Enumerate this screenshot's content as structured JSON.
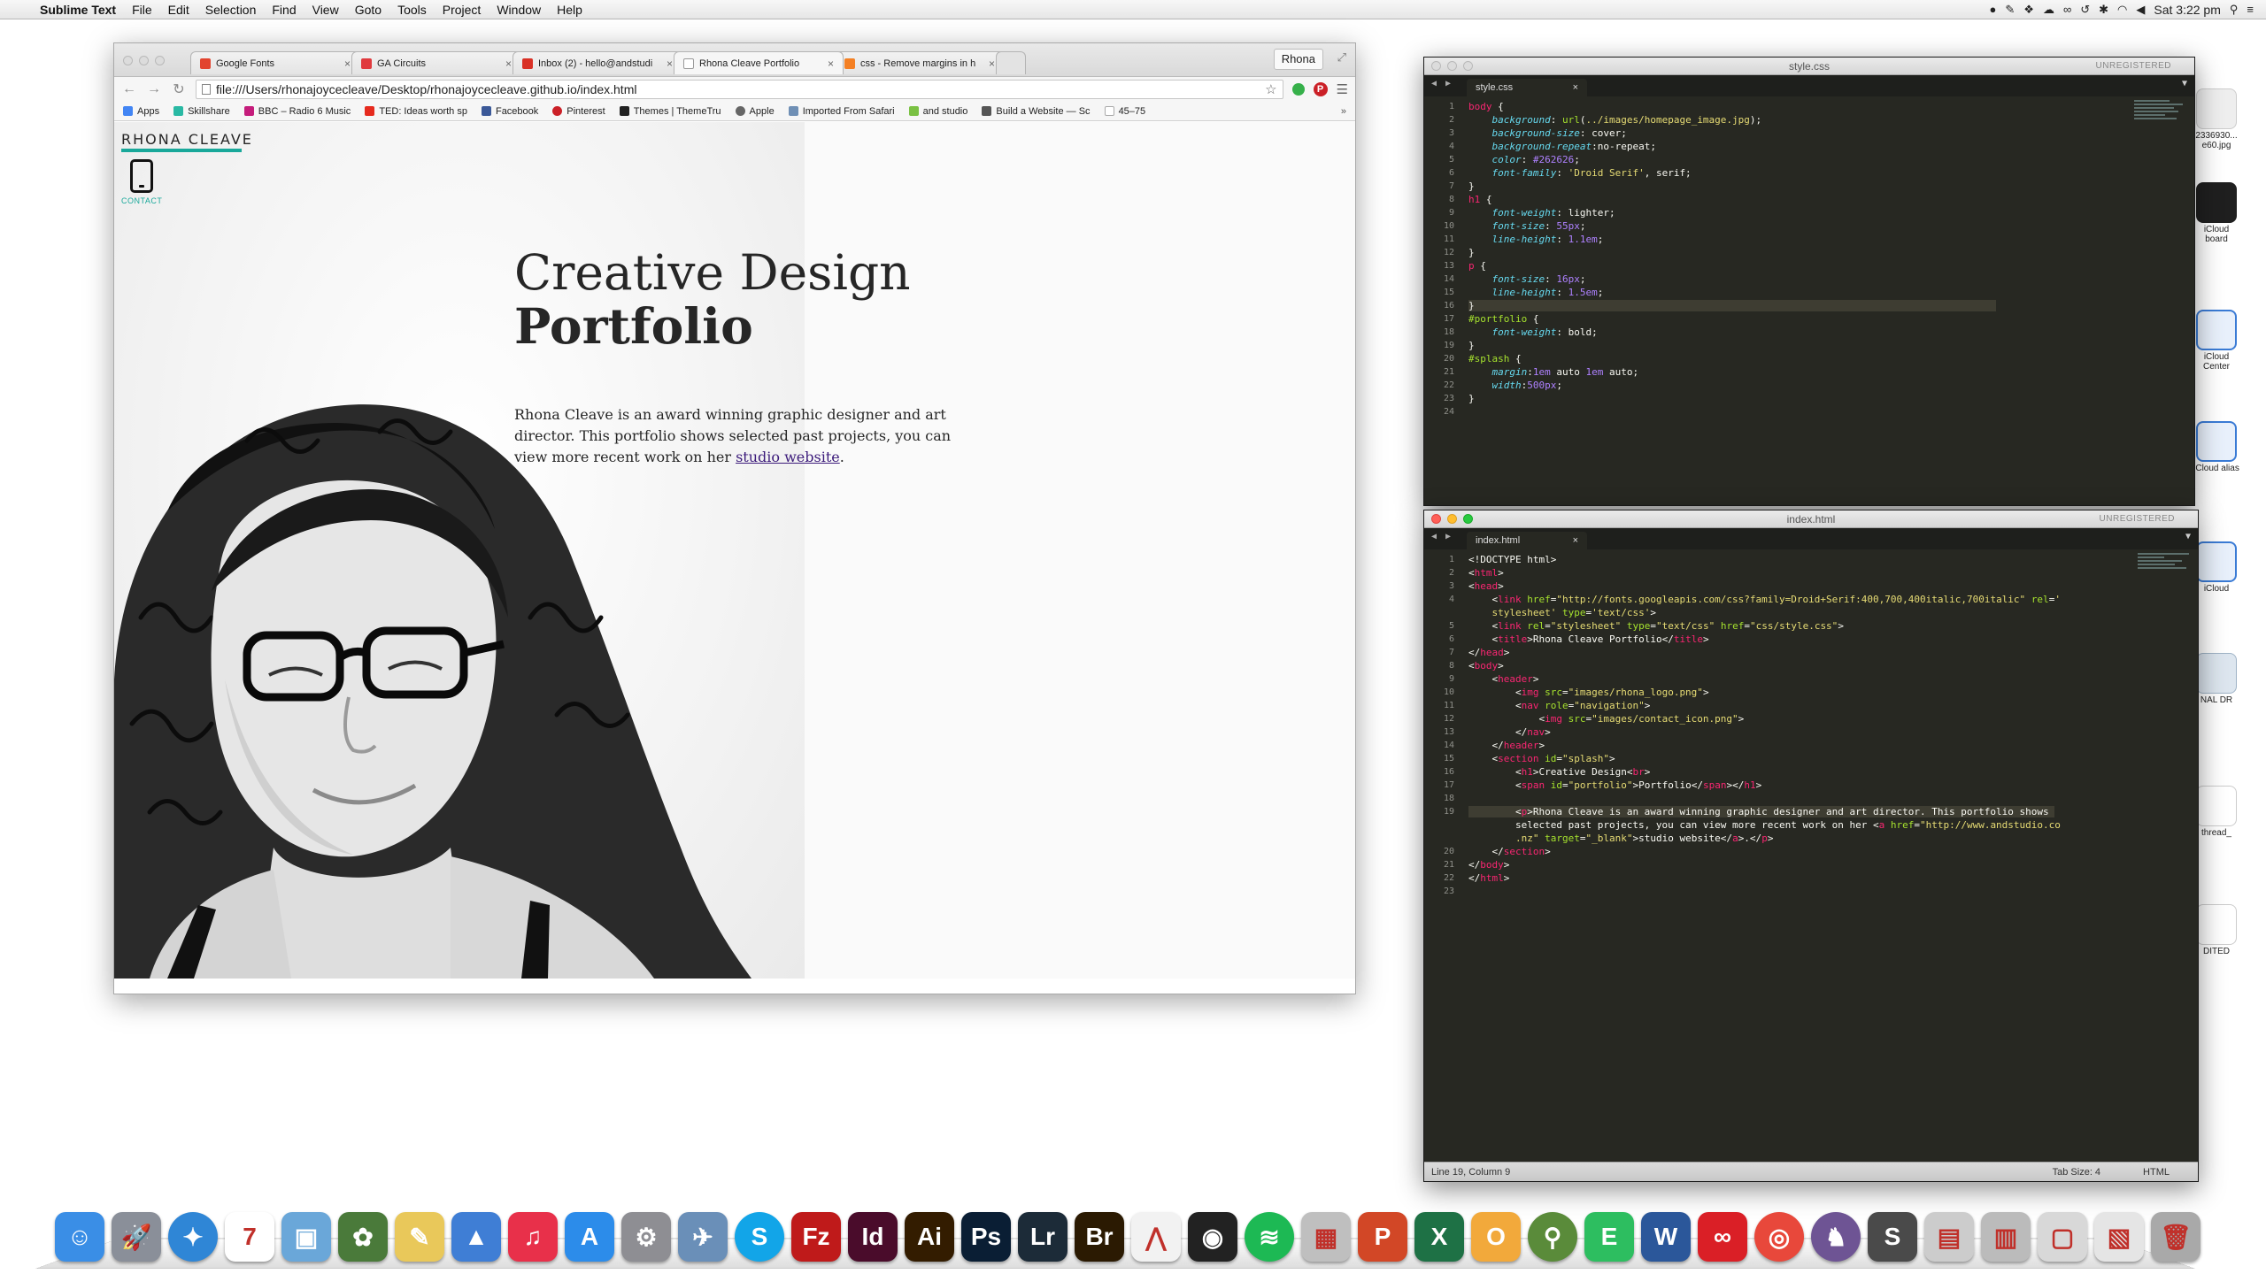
{
  "menubar": {
    "app_name": "Sublime Text",
    "menus": [
      "File",
      "Edit",
      "Selection",
      "Find",
      "View",
      "Goto",
      "Tools",
      "Project",
      "Window",
      "Help"
    ],
    "clock": "Sat 3:22 pm"
  },
  "browser": {
    "tabs": [
      {
        "title": "Google Fonts",
        "color": "#e2442f"
      },
      {
        "title": "GA Circuits",
        "color": "#e03a3e"
      },
      {
        "title": "Inbox (2) - hello@andstudi",
        "color": "#d93025"
      },
      {
        "title": "Rhona Cleave Portfolio",
        "color": "#9a9a9a"
      },
      {
        "title": "css - Remove margins in h",
        "color": "#f48024"
      }
    ],
    "active_tab": 3,
    "profile_label": "Rhona",
    "url": "file:///Users/rhonajoycecleave/Desktop/rhonajoycecleave.github.io/index.html",
    "bookmarks": [
      {
        "label": "Apps",
        "color": "#4285f4"
      },
      {
        "label": "Skillshare",
        "color": "#2ab9a4"
      },
      {
        "label": "BBC – Radio 6 Music",
        "color": "#c51d7c"
      },
      {
        "label": "TED: Ideas worth sp",
        "color": "#e62b1e"
      },
      {
        "label": "Facebook",
        "color": "#3b5998"
      },
      {
        "label": "Pinterest",
        "color": "#cb2027"
      },
      {
        "label": "Themes | ThemeTru",
        "color": "#222222"
      },
      {
        "label": "Apple",
        "color": "#666666"
      },
      {
        "label": "Imported From Safari",
        "color": "#6f8fb5"
      },
      {
        "label": "and studio",
        "color": "#7ac143"
      },
      {
        "label": "Build a Website — Sc",
        "color": "#555555"
      },
      {
        "label": "45–75",
        "color": "#aaaaaa"
      }
    ],
    "more_label": "»"
  },
  "site": {
    "logo": "RHONA CLEAVE",
    "contact_label": "CONTACT",
    "heading_line1": "Creative Design",
    "heading_line2": "Portfolio",
    "intro_text": "Rhona Cleave is an award winning graphic designer and art director. This portfolio shows selected past projects, you can view more recent work on her ",
    "link_text": "studio website",
    "intro_end": ".",
    "accent": "#19a89a"
  },
  "css_window": {
    "title": "style.css",
    "tab": "style.css",
    "unregistered": "UNREGISTERED",
    "line_numbers": [
      "1",
      "2",
      "3",
      "4",
      "5",
      "6",
      "7",
      "8",
      "9",
      "10",
      "11",
      "12",
      "13",
      "14",
      "15",
      "16",
      "17",
      "18",
      "19",
      "20",
      "21",
      "22",
      "23",
      "24"
    ]
  },
  "html_window": {
    "title": "index.html",
    "tab": "index.html",
    "unregistered": "UNREGISTERED",
    "line_numbers": [
      "1",
      "2",
      "3",
      "4",
      "",
      "5",
      "6",
      "7",
      "8",
      "9",
      "10",
      "11",
      "12",
      "13",
      "14",
      "15",
      "16",
      "17",
      "18",
      "19",
      "",
      "",
      "20",
      "21",
      "22",
      "23"
    ],
    "status_position": "Line 19, Column 9",
    "status_tabsize": "Tab Size: 4",
    "status_syntax": "HTML"
  },
  "desktop_icons": [
    "2336930... e60.jpg",
    "iCloud board",
    "iCloud Center",
    "iCloud alias",
    "iCloud",
    "NAL DR",
    "thread_",
    "DITED"
  ],
  "dock": [
    {
      "name": "finder",
      "glyph": "☺",
      "color": "#3a8ee6"
    },
    {
      "name": "launchpad",
      "glyph": "🚀",
      "color": "#8a8f99"
    },
    {
      "name": "safari",
      "glyph": "✦",
      "color": "#2f86d6"
    },
    {
      "name": "calendar",
      "glyph": "7",
      "color": "#ffffff"
    },
    {
      "name": "preview",
      "glyph": "▣",
      "color": "#6aa7d9"
    },
    {
      "name": "iphoto",
      "glyph": "✿",
      "color": "#4a7a3a"
    },
    {
      "name": "notes",
      "glyph": "✎",
      "color": "#e9c85a"
    },
    {
      "name": "keynote",
      "glyph": "▲",
      "color": "#3f7ed5"
    },
    {
      "name": "itunes",
      "glyph": "♫",
      "color": "#e8304a"
    },
    {
      "name": "app-store",
      "glyph": "A",
      "color": "#2c8cea"
    },
    {
      "name": "system-preferences",
      "glyph": "⚙",
      "color": "#8e8e93"
    },
    {
      "name": "directory-utility",
      "glyph": "✈",
      "color": "#6a8fb8"
    },
    {
      "name": "skype",
      "glyph": "S",
      "color": "#12a5e8"
    },
    {
      "name": "filezilla",
      "glyph": "Fz",
      "color": "#bf1a1a"
    },
    {
      "name": "indesign",
      "glyph": "Id",
      "color": "#4a0c2b"
    },
    {
      "name": "illustrator",
      "glyph": "Ai",
      "color": "#331c00"
    },
    {
      "name": "photoshop",
      "glyph": "Ps",
      "color": "#0a1e34"
    },
    {
      "name": "lightroom",
      "glyph": "Lr",
      "color": "#1c2b38"
    },
    {
      "name": "bridge",
      "glyph": "Br",
      "color": "#2b1a02"
    },
    {
      "name": "acrobat",
      "glyph": "⋀",
      "color": "#f2f2f2"
    },
    {
      "name": "quicktime",
      "glyph": "◉",
      "color": "#222222"
    },
    {
      "name": "spotify",
      "glyph": "≋",
      "color": "#1db954"
    },
    {
      "name": "calculator",
      "glyph": "▦",
      "color": "#bfbfbf"
    },
    {
      "name": "powerpoint",
      "glyph": "P",
      "color": "#d24726"
    },
    {
      "name": "excel",
      "glyph": "X",
      "color": "#1e7145"
    },
    {
      "name": "outlook",
      "glyph": "O",
      "color": "#f2a93b"
    },
    {
      "name": "network",
      "glyph": "⚲",
      "color": "#5a8b3a"
    },
    {
      "name": "evernote",
      "glyph": "E",
      "color": "#2dbe60"
    },
    {
      "name": "word",
      "glyph": "W",
      "color": "#2b579a"
    },
    {
      "name": "creative-cloud",
      "glyph": "∞",
      "color": "#da1f26"
    },
    {
      "name": "chrome",
      "glyph": "◎",
      "color": "#e8483b"
    },
    {
      "name": "github",
      "glyph": "♞",
      "color": "#6e5494"
    },
    {
      "name": "sublime-text",
      "glyph": "S",
      "color": "#4a4a4a"
    },
    {
      "name": "downloads",
      "glyph": "▤",
      "color": "#cccccc"
    },
    {
      "name": "documents",
      "glyph": "▥",
      "color": "#bbbbbb"
    },
    {
      "name": "desktop-stack",
      "glyph": "▢",
      "color": "#d8d8d8"
    },
    {
      "name": "pdf-stack",
      "glyph": "▧",
      "color": "#e5e5e5"
    },
    {
      "name": "trash",
      "glyph": "🗑",
      "color": "#a9a9a9"
    }
  ]
}
